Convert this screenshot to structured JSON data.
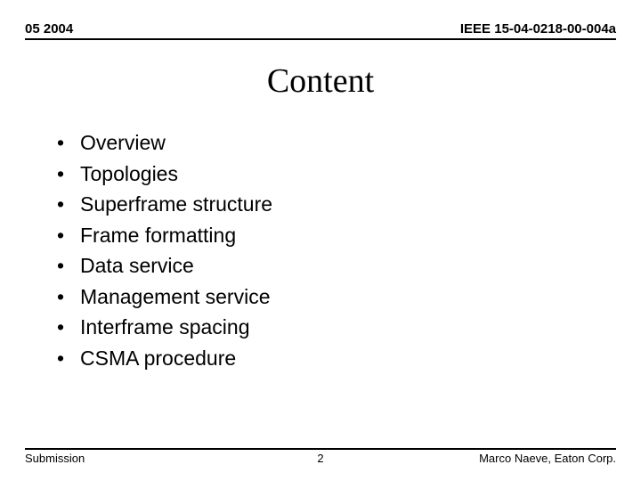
{
  "header": {
    "left": "05 2004",
    "right": "IEEE 15-04-0218-00-004a"
  },
  "title": "Content",
  "bullets": [
    "Overview",
    "Topologies",
    "Superframe structure",
    "Frame formatting",
    "Data service",
    "Management service",
    "Interframe spacing",
    "CSMA procedure"
  ],
  "footer": {
    "left": "Submission",
    "center": "2",
    "right": "Marco Naeve, Eaton Corp."
  }
}
